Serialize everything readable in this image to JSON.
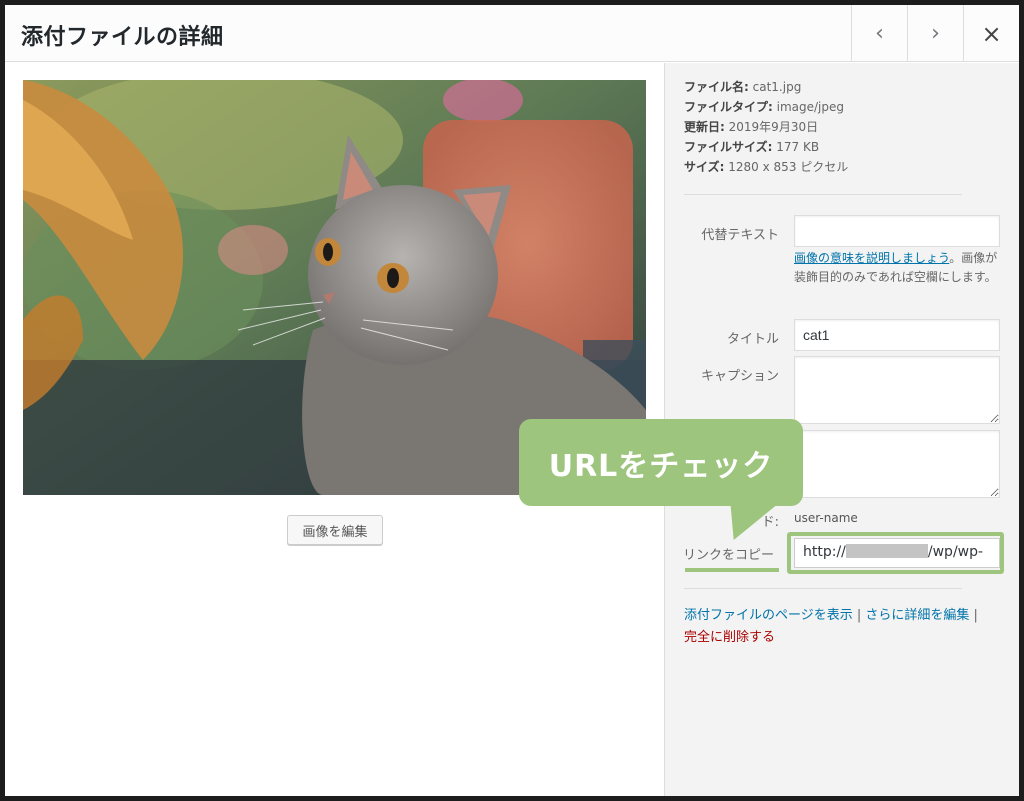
{
  "modal": {
    "title": "添付ファイルの詳細",
    "prev_icon": "‹",
    "next_icon": "›",
    "close_icon": "×"
  },
  "image_panel": {
    "edit_button": "画像を編集"
  },
  "details": {
    "filename_label": "ファイル名:",
    "filename": "cat1.jpg",
    "filetype_label": "ファイルタイプ:",
    "filetype": "image/jpeg",
    "uploaded_label": "更新日:",
    "uploaded": "2019年9月30日",
    "filesize_label": "ファイルサイズ:",
    "filesize": "177 KB",
    "dimensions_label": "サイズ:",
    "dimensions": "1280 x 853 ピクセル"
  },
  "form": {
    "alt_label": "代替テキスト",
    "alt_value": "",
    "alt_help_link": "画像の意味を説明しましょう",
    "alt_help_text": "。画像が装飾目的のみであれば空欄にします。",
    "title_label": "タイトル",
    "title_value": "cat1",
    "caption_label": "キャプション",
    "caption_value": "",
    "description_value": "",
    "uploader_label_visible": "ド:",
    "uploader_value": "user-name",
    "copy_link_label": "リンクをコピー",
    "url_prefix": "http://",
    "url_suffix": "/wp/wp-"
  },
  "actions": {
    "view_page": "添付ファイルのページを表示",
    "sep1": " | ",
    "edit_more": "さらに詳細を編集",
    "sep2": " |",
    "delete": "完全に削除する"
  },
  "annotation": {
    "callout_text": "URLをチェック",
    "callout_color": "#9dc57e"
  }
}
